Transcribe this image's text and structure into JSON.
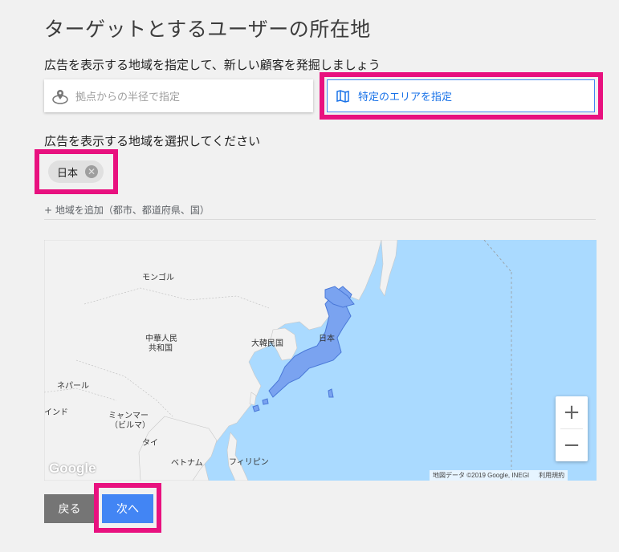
{
  "page": {
    "title": "ターゲットとするユーザーの所在地",
    "subtitle": "広告を表示する地域を指定して、新しい顧客を発掘しましょう"
  },
  "options": {
    "radius_label": "拠点からの半径で指定",
    "area_label": "特定のエリアを指定",
    "selected": "area"
  },
  "regions": {
    "label": "広告を表示する地域を選択してください",
    "chips": [
      {
        "label": "日本"
      }
    ],
    "add_link": "+ 地域を追加（都市、都道府県、国）"
  },
  "map": {
    "labels": {
      "mongolia": "モンゴル",
      "china_line1": "中華人民",
      "china_line2": "共和国",
      "korea": "大韓民国",
      "japan": "日本",
      "nepal": "ネパール",
      "india": "インド",
      "myanmar_line1": "ミャンマー",
      "myanmar_line2": "（ビルマ）",
      "thailand": "タイ",
      "vietnam": "ベトナム",
      "philippines": "フィリピン"
    },
    "zoom_in": "+",
    "zoom_out": "−",
    "attribution": "地図データ ©2019 Google, INEGI",
    "terms": "利用規約",
    "logo": "Google",
    "colors": {
      "water": "#aadaff",
      "land": "#f2f2f2",
      "highlight": "#7aa3f0"
    }
  },
  "buttons": {
    "back": "戻る",
    "next": "次へ"
  },
  "highlight_color": "#e8117f"
}
